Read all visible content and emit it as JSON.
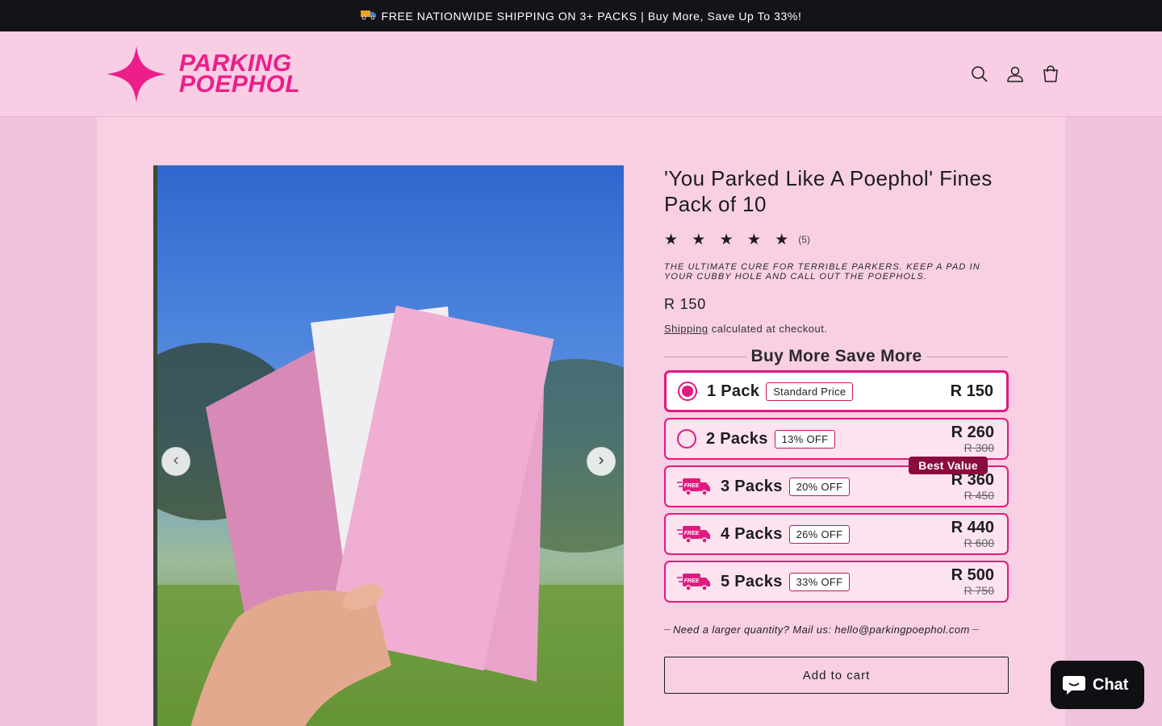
{
  "announcement": {
    "text": "FREE NATIONWIDE SHIPPING ON 3+ PACKS | Buy More, Save Up To 33%!",
    "icon": "truck-icon"
  },
  "header": {
    "logo_line1": "PARKING",
    "logo_line2": "POEPHOL",
    "icons": [
      "search-icon",
      "account-icon",
      "cart-icon"
    ],
    "brand_color": "#ec1e8a"
  },
  "gallery": {
    "prev_icon": "chevron-left-icon",
    "next_icon": "chevron-right-icon"
  },
  "product": {
    "title": "'You Parked Like A Poephol' Fines Pack of 10",
    "stars": "★ ★ ★ ★ ★",
    "rating_value": 5,
    "review_count": "(5)",
    "tagline": "THE ULTIMATE CURE FOR TERRIBLE PARKERS. KEEP A PAD IN YOUR CUBBY HOLE AND CALL OUT THE POEPHOLS.",
    "price": "R 150",
    "shipping_link": "Shipping",
    "shipping_suffix": " calculated at checkout."
  },
  "bundles": {
    "heading": "Buy More Save More",
    "best_value_label": "Best Value",
    "options": [
      {
        "label": "1 Pack",
        "badge": "Standard Price",
        "price": "R 150",
        "old_price": "",
        "selected": true,
        "free_shipping": false
      },
      {
        "label": "2 Packs",
        "badge": "13% OFF",
        "price": "R 260",
        "old_price": "R 300",
        "selected": false,
        "free_shipping": false
      },
      {
        "label": "3 Packs",
        "badge": "20% OFF",
        "price": "R 360",
        "old_price": "R 450",
        "selected": false,
        "free_shipping": true
      },
      {
        "label": "4 Packs",
        "badge": "26% OFF",
        "price": "R 440",
        "old_price": "R 600",
        "selected": false,
        "free_shipping": true
      },
      {
        "label": "5 Packs",
        "badge": "33% OFF",
        "price": "R 500",
        "old_price": "R 750",
        "selected": false,
        "free_shipping": true
      }
    ],
    "free_icon_text": "FREE",
    "accent_color": "#e2197f"
  },
  "larger_quantity": "Need a larger quantity? Mail us: hello@parkingpoephol.com",
  "add_to_cart": "Add to cart",
  "chat": {
    "label": "Chat",
    "icon": "chat-bubble-icon"
  }
}
